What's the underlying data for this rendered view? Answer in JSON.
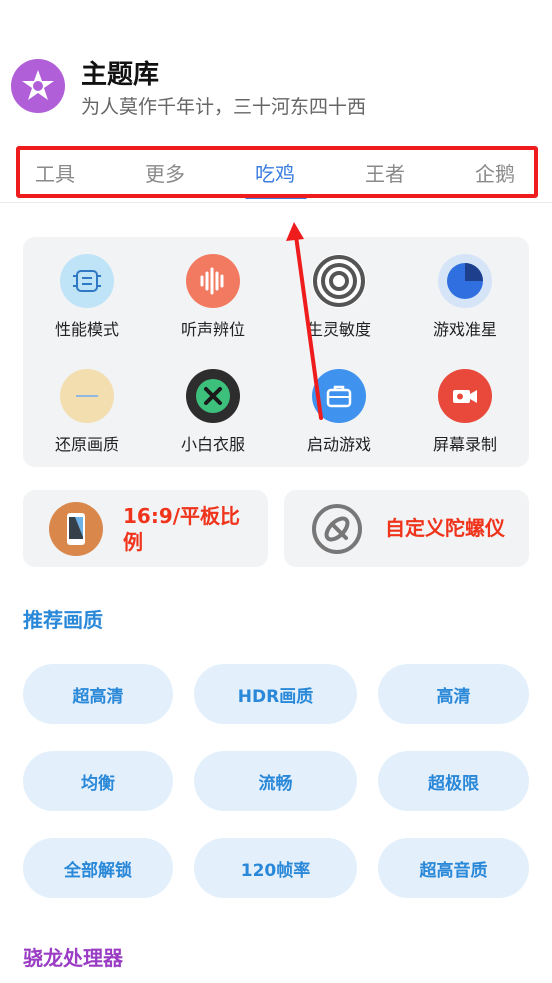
{
  "header": {
    "title": "主题库",
    "subtitle": "为人莫作千年计，三十河东四十西"
  },
  "tabs": [
    {
      "label": "工具"
    },
    {
      "label": "更多"
    },
    {
      "label": "吃鸡"
    },
    {
      "label": "王者"
    },
    {
      "label": "企鹅"
    }
  ],
  "features": [
    {
      "label": "性能模式",
      "icon": "circuit-icon"
    },
    {
      "label": "听声辨位",
      "icon": "sound-wave-icon"
    },
    {
      "label": "生灵敏度",
      "icon": "target-icon"
    },
    {
      "label": "游戏准星",
      "icon": "crosshair-pie-icon"
    },
    {
      "label": "还原画质",
      "icon": "restore-icon"
    },
    {
      "label": "小白衣服",
      "icon": "close-circle-icon"
    },
    {
      "label": "启动游戏",
      "icon": "briefcase-icon"
    },
    {
      "label": "屏幕录制",
      "icon": "video-camera-icon"
    }
  ],
  "wide_cards": [
    {
      "label_line1": "16:9/平板比",
      "label_line2": "例",
      "icon": "phone-icon"
    },
    {
      "label": "自定义陀螺仪",
      "icon": "gyroscope-icon"
    }
  ],
  "sections": {
    "recommended": "推荐画质",
    "snapdragon": "骁龙处理器"
  },
  "quality_options": [
    "超高清",
    "HDR画质",
    "高清",
    "均衡",
    "流畅",
    "超极限",
    "全部解锁",
    "120帧率",
    "超高音质"
  ],
  "colors": {
    "accent": "#3a7ce0",
    "highlight": "#ee1c1c",
    "section_blue": "#2a88d8",
    "section_purple": "#9a3cc4",
    "logo": "#b05fd8"
  }
}
